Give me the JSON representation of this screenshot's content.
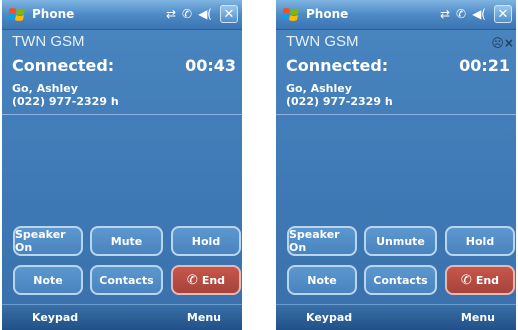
{
  "screens": [
    {
      "title": "Phone",
      "close": "✕",
      "status_icons": [
        "⇄",
        "✆",
        "◀("
      ],
      "carrier": "TWN GSM",
      "mute_indicator": "",
      "connection_label": "Connected:",
      "timer": "00:43",
      "contact_name": "Go, Ashley",
      "contact_phone": "(022) 977-2329 h",
      "buttons": {
        "speaker": "Speaker On",
        "mute": "Mute",
        "hold": "Hold",
        "note": "Note",
        "contacts": "Contacts",
        "end": "End"
      },
      "softkeys": {
        "left": "Keypad",
        "right": "Menu"
      }
    },
    {
      "title": "Phone",
      "close": "✕",
      "status_icons": [
        "⇄",
        "✆",
        "◀("
      ],
      "carrier": "TWN GSM",
      "mute_indicator": "☹×",
      "connection_label": "Connected:",
      "timer": "00:21",
      "contact_name": "Go, Ashley",
      "contact_phone": "(022) 977-2329 h",
      "buttons": {
        "speaker": "Speaker On",
        "mute": "Unmute",
        "hold": "Hold",
        "note": "Note",
        "contacts": "Contacts",
        "end": "End"
      },
      "softkeys": {
        "left": "Keypad",
        "right": "Menu"
      }
    }
  ],
  "icons": {
    "windows_logo": "windows-logo-icon",
    "phone": "✆"
  },
  "colors": {
    "background": "#3f7ab6",
    "title_bar": "#4d8ac6",
    "end_button": "#b54b41"
  }
}
